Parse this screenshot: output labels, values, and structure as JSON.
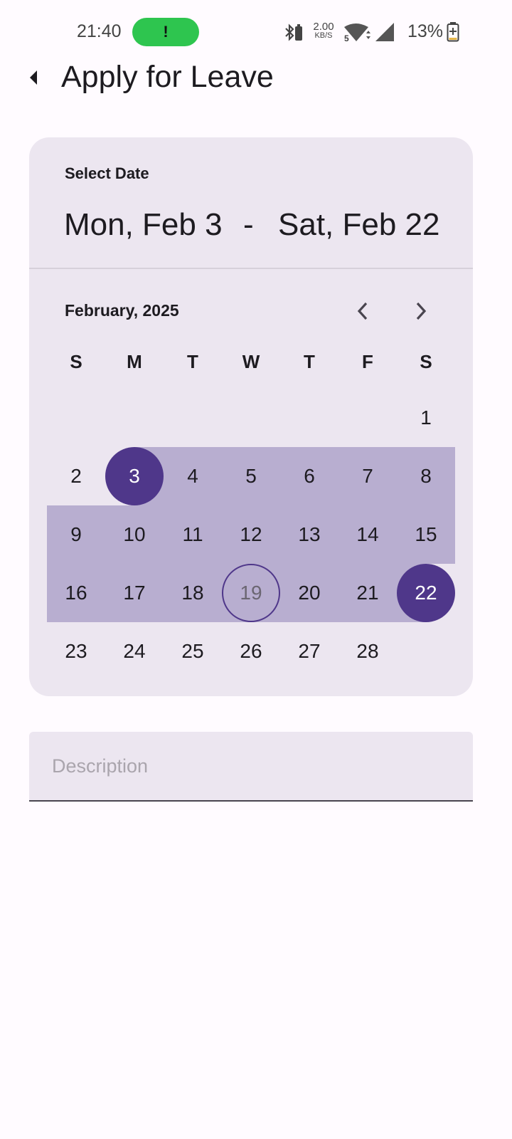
{
  "status_bar": {
    "time": "21:40",
    "pill_icon": "!",
    "net_speed_value": "2.00",
    "net_speed_unit": "KB/S",
    "battery": "13%"
  },
  "header": {
    "title": "Apply for Leave"
  },
  "picker": {
    "header_label": "Select Date",
    "start_date": "Mon, Feb 3",
    "separator": "-",
    "end_date": "Sat, Feb 22",
    "month_label": "February, 2025",
    "weekdays": [
      "S",
      "M",
      "T",
      "W",
      "T",
      "F",
      "S"
    ],
    "first_weekday_index": 6,
    "days_in_month": 28,
    "range_start_day": 3,
    "range_end_day": 22,
    "today_day": 19
  },
  "description": {
    "placeholder": "Description"
  },
  "colors": {
    "accent": "#4f378a",
    "range": "#b8aed0",
    "surface": "#ece6f0",
    "status_pill": "#2ec54f"
  },
  "icons": [
    "back-icon",
    "bluetooth-icon",
    "wifi-icon",
    "signal-icon",
    "battery-icon",
    "chevron-left-icon",
    "chevron-right-icon"
  ]
}
